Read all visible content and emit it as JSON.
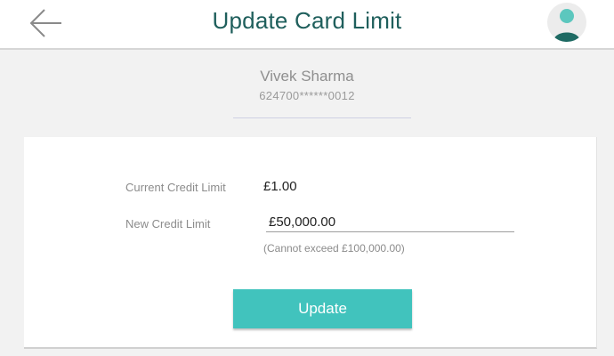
{
  "header": {
    "title": "Update Card Limit",
    "back_icon": "arrow-left-icon",
    "avatar_icon": "user-avatar-icon"
  },
  "account": {
    "name": "Vivek Sharma",
    "card_number": "624700******0012"
  },
  "form": {
    "current_limit_label": "Current Credit Limit",
    "current_limit_value": "£1.00",
    "new_limit_label": "New Credit Limit",
    "new_limit_value": "£50,000.00",
    "hint": "(Cannot exceed £100,000.00)"
  },
  "actions": {
    "update_label": "Update"
  },
  "colors": {
    "title": "#1f5f5c",
    "accent": "#41c3bd",
    "avatar_head": "#5cc7be",
    "avatar_body": "#1e6a63"
  }
}
